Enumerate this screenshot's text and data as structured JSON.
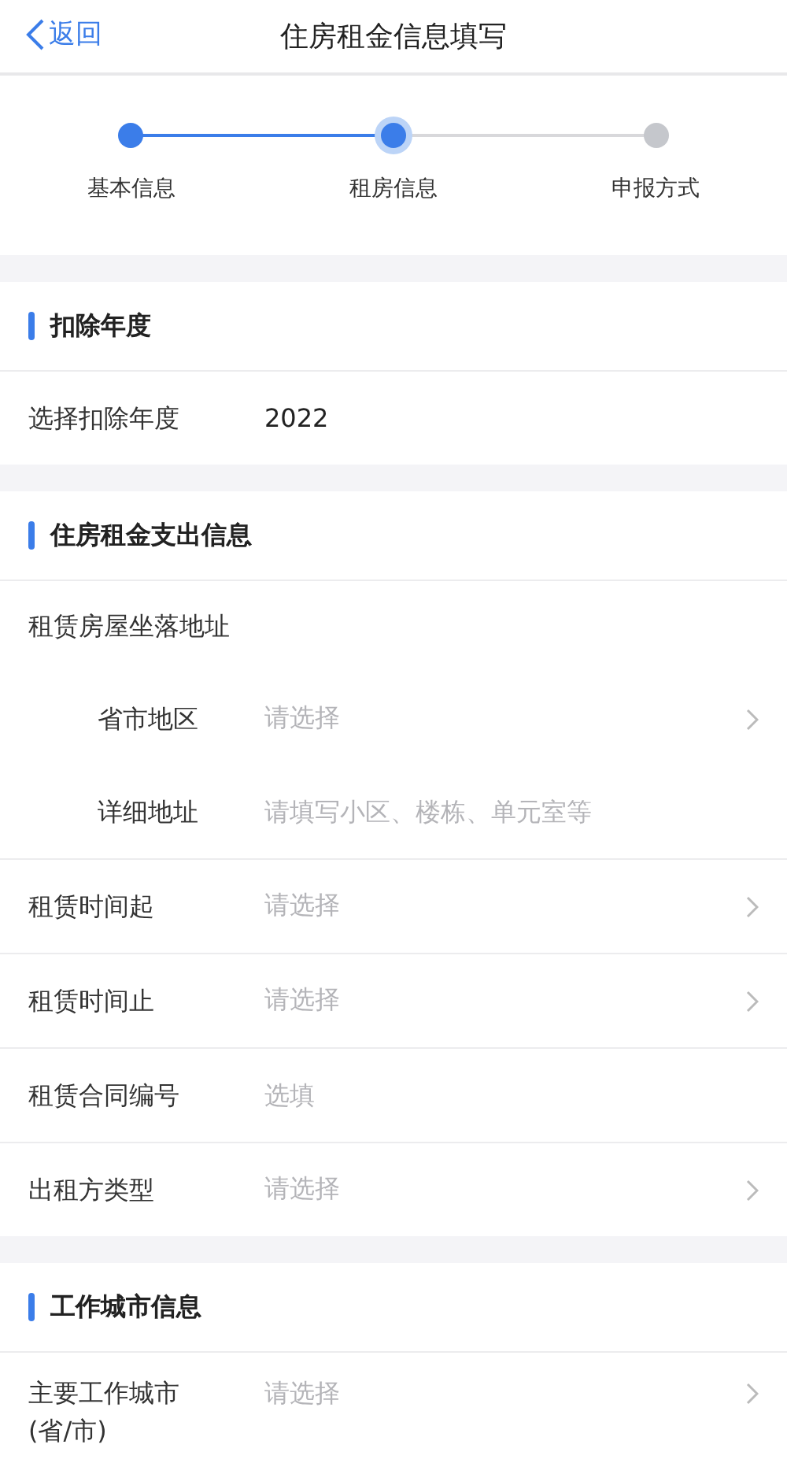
{
  "nav": {
    "back": "返回",
    "title": "住房租金信息填写"
  },
  "steps": [
    {
      "label": "基本信息",
      "reached": true,
      "selected": false
    },
    {
      "label": "租房信息",
      "reached": true,
      "selected": true
    },
    {
      "label": "申报方式",
      "reached": false,
      "selected": false
    }
  ],
  "sections": [
    {
      "title": "扣除年度",
      "rows": [
        {
          "kind": "value",
          "label": "选择扣除年度",
          "value": "2022"
        }
      ]
    },
    {
      "title": "住房租金支出信息",
      "rows": [
        {
          "kind": "group",
          "label": "租赁房屋坐落地址",
          "children": [
            {
              "kind": "select",
              "label": "省市地区",
              "placeholder": "请选择"
            },
            {
              "kind": "input",
              "label": "详细地址",
              "placeholder": "请填写小区、楼栋、单元室等"
            }
          ]
        },
        {
          "kind": "select",
          "label": "租赁时间起",
          "placeholder": "请选择"
        },
        {
          "kind": "select",
          "label": "租赁时间止",
          "placeholder": "请选择"
        },
        {
          "kind": "input",
          "label": "租赁合同编号",
          "placeholder": "选填"
        },
        {
          "kind": "select",
          "label": "出租方类型",
          "placeholder": "请选择"
        }
      ]
    },
    {
      "title": "工作城市信息",
      "rows": [
        {
          "kind": "select",
          "label": "主要工作城市(省/市)",
          "placeholder": "请选择"
        }
      ]
    }
  ]
}
